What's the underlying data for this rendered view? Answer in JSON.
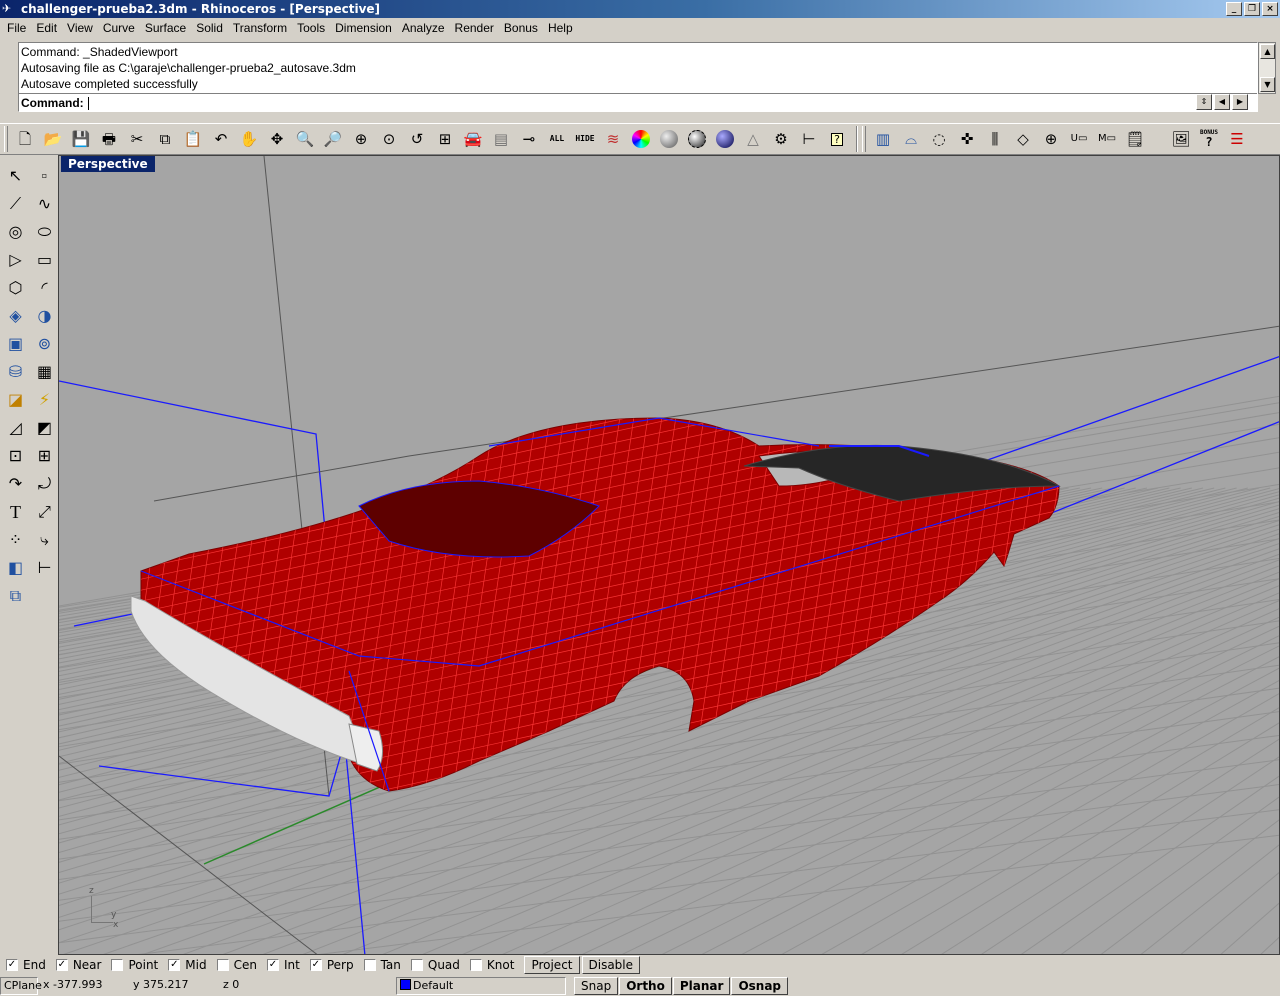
{
  "window": {
    "title": "challenger-prueba2.3dm - Rhinoceros - [Perspective]"
  },
  "menu": [
    "File",
    "Edit",
    "View",
    "Curve",
    "Surface",
    "Solid",
    "Transform",
    "Tools",
    "Dimension",
    "Analyze",
    "Render",
    "Bonus",
    "Help"
  ],
  "command": {
    "history": [
      "Command: _ShadedViewport",
      "Autosaving file as C:\\garaje\\challenger-prueba2_autosave.3dm",
      "Autosave completed successfully"
    ],
    "prompt": "Command:"
  },
  "toolbar": {
    "icons": [
      "new-icon",
      "open-icon",
      "save-icon",
      "print-icon",
      "cut-icon",
      "copy-icon",
      "paste-icon",
      "undo-icon",
      "pan-icon",
      "rotate-view-icon",
      "zoom-icon",
      "zoom-window-icon",
      "zoom-extents-icon",
      "zoom-selected-icon",
      "undo-view-icon",
      "four-viewports-icon",
      "car-icon",
      "layers-icon",
      "select-icon",
      "show-all-icon",
      "hide-icon",
      "materials-icon",
      "color-wheel-icon",
      "sphere-gray-icon",
      "sphere-gloss-icon",
      "sphere-blue-icon",
      "cone-icon",
      "options-gear-icon",
      "dimension-icon",
      "help-icon"
    ],
    "all_label": "ALL",
    "hide_label": "HIDE",
    "right_icons": [
      "surface-icon",
      "curvature-icon",
      "lasso-icon",
      "move-icon",
      "align-icon",
      "transform-icon",
      "target-icon",
      "untrim-icon",
      "match-icon",
      "notes-icon",
      "render-icon",
      "bonus-icon",
      "list-icon"
    ],
    "bonus_label": "BONUS",
    "u_label": "U",
    "m_label": "M"
  },
  "left_tools": [
    "point-icon",
    "select-points-icon",
    "polyline-icon",
    "curve-icon",
    "circle-icon",
    "ellipse-icon",
    "polygon-icon",
    "rectangle-icon",
    "arc-icon",
    "fillet-curve-icon",
    "surface-corner-icon",
    "surface-edge-icon",
    "box-icon",
    "sphere-tool-icon",
    "extrude-icon",
    "boolean-icon",
    "mesh-icon",
    "explode-icon",
    "split-icon",
    "trim-icon",
    "group-icon",
    "array-icon",
    "rotate-icon",
    "scale-icon",
    "text-icon",
    "move-tool-icon",
    "snap-grid-icon",
    "analyze-icon",
    "layer-icon",
    "render-tool-icon"
  ],
  "viewport": {
    "label": "Perspective",
    "axes": [
      "z",
      "y",
      "x"
    ]
  },
  "osnap": {
    "items": [
      {
        "label": "End",
        "checked": true
      },
      {
        "label": "Near",
        "checked": true
      },
      {
        "label": "Point",
        "checked": false
      },
      {
        "label": "Mid",
        "checked": true
      },
      {
        "label": "Cen",
        "checked": false
      },
      {
        "label": "Int",
        "checked": true
      },
      {
        "label": "Perp",
        "checked": true
      },
      {
        "label": "Tan",
        "checked": false
      },
      {
        "label": "Quad",
        "checked": false
      },
      {
        "label": "Knot",
        "checked": false
      }
    ],
    "project": "Project",
    "disable": "Disable"
  },
  "status": {
    "cplane": "CPlane",
    "x": "x -377.993",
    "y": "y 375.217",
    "z": "z 0",
    "layer": "Default",
    "layer_color": "#0000ff",
    "snap": "Snap",
    "ortho": "Ortho",
    "planar": "Planar",
    "osnap": "Osnap"
  },
  "colors": {
    "body": "#b00000",
    "wire": "#ff3030",
    "edge": "#1a1aff",
    "grid": "#8f8f8f",
    "viewport_bg": "#a5a5a5"
  }
}
